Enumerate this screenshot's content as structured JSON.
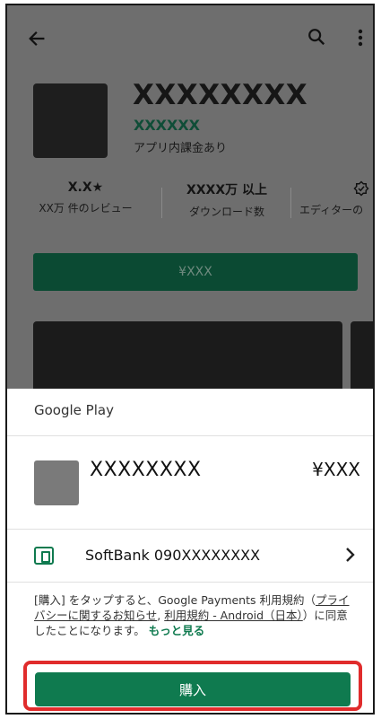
{
  "app": {
    "title": "XXXXXXXX",
    "developer": "XXXXXX",
    "in_app_purchase": "アプリ内課金あり"
  },
  "stats": [
    {
      "value": "X.X★",
      "label": "XX万 件のレビュー"
    },
    {
      "value": "XXXX万 以上",
      "label": "ダウンロード数"
    },
    {
      "value": "",
      "label": "エディターの"
    }
  ],
  "price_button": {
    "label": "¥XXX"
  },
  "sheet": {
    "header": "Google Play",
    "item_name": "XXXXXXXX",
    "item_price": "¥XXX",
    "payment_method": "SoftBank 090XXXXXXXX",
    "terms": {
      "part1": "[購入] をタップすると、Google Payments 利用規約（",
      "link1": "プライバシーに関するお知らせ",
      "sep1": ", ",
      "link2": "利用規約 - Android（日本）",
      "part2": "）に同意したことになります。",
      "more": "もっと見る"
    },
    "buy_label": "購入"
  },
  "icons": {
    "back": "arrow-left",
    "search": "search",
    "more": "more-vertical",
    "payment": "phone-bill",
    "chevron": "chevron-right",
    "editor": "badge-check"
  },
  "colors": {
    "accent": "#0f7a4f",
    "highlight": "#e02c2c",
    "scrim": "#6e6e6e"
  }
}
